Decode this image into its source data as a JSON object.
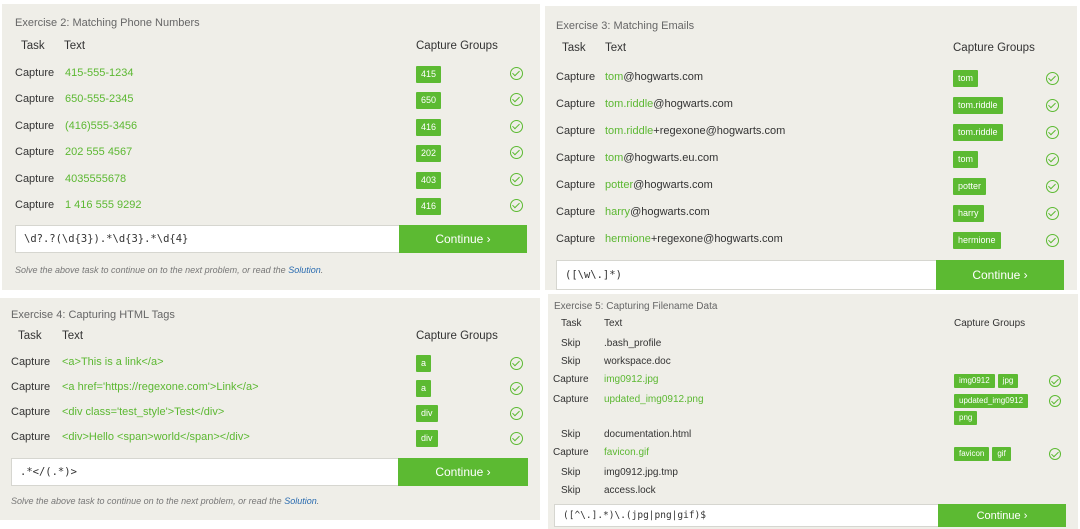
{
  "ex2": {
    "title": "Exercise 2: Matching Phone Numbers",
    "col_task": "Task",
    "col_text": "Text",
    "col_groups": "Capture Groups",
    "rows": [
      {
        "task": "Capture",
        "text": "415-555-1234",
        "groups": [
          "415"
        ]
      },
      {
        "task": "Capture",
        "text": "650-555-2345",
        "groups": [
          "650"
        ]
      },
      {
        "task": "Capture",
        "text": "(416)555-3456",
        "groups": [
          "416"
        ]
      },
      {
        "task": "Capture",
        "text": "202 555 4567",
        "groups": [
          "202"
        ]
      },
      {
        "task": "Capture",
        "text": "4035555678",
        "groups": [
          "403"
        ]
      },
      {
        "task": "Capture",
        "text": "1 416 555 9292",
        "groups": [
          "416"
        ]
      }
    ],
    "input_value": "\\d?.?(\\d{3}).*\\d{3}.*\\d{4}",
    "continue_label": "Continue ›",
    "footer_text": "Solve the above task to continue on to the next problem, or read the ",
    "footer_link": "Solution",
    "footer_end": "."
  },
  "ex3": {
    "title": "Exercise 3: Matching Emails",
    "col_task": "Task",
    "col_text": "Text",
    "col_groups": "Capture Groups",
    "rows": [
      {
        "task": "Capture",
        "hl": "tom",
        "rest": "@hogwarts.com",
        "groups": [
          "tom"
        ]
      },
      {
        "task": "Capture",
        "hl": "tom.riddle",
        "rest": "@hogwarts.com",
        "groups": [
          "tom.riddle"
        ]
      },
      {
        "task": "Capture",
        "hl": "tom.riddle",
        "rest": "+regexone@hogwarts.com",
        "groups": [
          "tom.riddle"
        ]
      },
      {
        "task": "Capture",
        "hl": "tom",
        "rest": "@hogwarts.eu.com",
        "groups": [
          "tom"
        ]
      },
      {
        "task": "Capture",
        "hl": "potter",
        "rest": "@hogwarts.com",
        "groups": [
          "potter"
        ]
      },
      {
        "task": "Capture",
        "hl": "harry",
        "rest": "@hogwarts.com",
        "groups": [
          "harry"
        ]
      },
      {
        "task": "Capture",
        "hl": "hermione",
        "rest": "+regexone@hogwarts.com",
        "groups": [
          "hermione"
        ]
      }
    ],
    "input_value": "([\\w\\.]*)",
    "continue_label": "Continue ›"
  },
  "ex4": {
    "title": "Exercise 4: Capturing HTML Tags",
    "col_task": "Task",
    "col_text": "Text",
    "col_groups": "Capture Groups",
    "rows": [
      {
        "task": "Capture",
        "text": "<a>This is a link</a>",
        "groups": [
          "a"
        ]
      },
      {
        "task": "Capture",
        "text": "<a href='https://regexone.com'>Link</a>",
        "groups": [
          "a"
        ]
      },
      {
        "task": "Capture",
        "text": "<div class='test_style'>Test</div>",
        "groups": [
          "div"
        ]
      },
      {
        "task": "Capture",
        "text": "<div>Hello <span>world</span></div>",
        "groups": [
          "div"
        ]
      }
    ],
    "input_value": ".*</(.*)>",
    "continue_label": "Continue ›",
    "footer_text": "Solve the above task to continue on to the next problem, or read the ",
    "footer_link": "Solution",
    "footer_end": "."
  },
  "ex5": {
    "title": "Exercise 5: Capturing Filename Data",
    "col_task": "Task",
    "col_text": "Text",
    "col_groups": "Capture Groups",
    "rows": [
      {
        "task": "Skip",
        "text": ".bash_profile",
        "groups": [],
        "ok": false
      },
      {
        "task": "Skip",
        "text": "workspace.doc",
        "groups": [],
        "ok": false
      },
      {
        "task": "Capture",
        "text": "img0912.jpg",
        "groups": [
          "img0912",
          "jpg"
        ],
        "ok": true
      },
      {
        "task": "Capture",
        "text": "updated_img0912.png",
        "groups": [
          "updated_img0912",
          "png"
        ],
        "ok": true
      },
      {
        "task": "Skip",
        "text": "documentation.html",
        "groups": [],
        "ok": false
      },
      {
        "task": "Capture",
        "text": "favicon.gif",
        "groups": [
          "favicon",
          "gif"
        ],
        "ok": true
      },
      {
        "task": "Skip",
        "text": "img0912.jpg.tmp",
        "groups": [],
        "ok": false
      },
      {
        "task": "Skip",
        "text": "access.lock",
        "groups": [],
        "ok": false
      }
    ],
    "input_value": "([^\\.].*)\\.(jpg|png|gif)$",
    "continue_label": "Continue ›"
  },
  "colors": {
    "accent": "#5cba32",
    "panel": "#efeee8",
    "link": "#2b6cb0"
  }
}
